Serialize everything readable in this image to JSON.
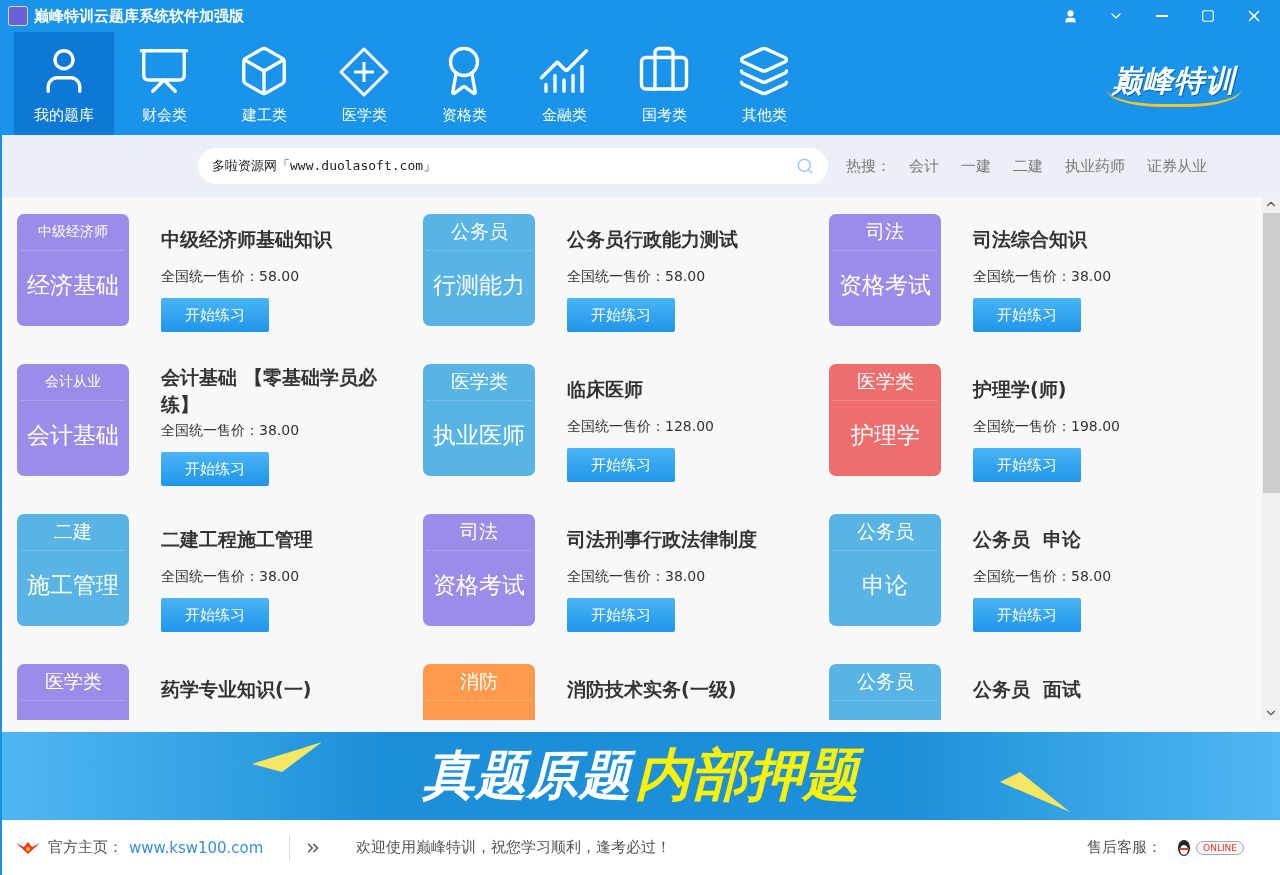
{
  "window": {
    "title": "巅峰特训云题库系统软件加强版"
  },
  "nav": [
    {
      "label": "我的题库",
      "selected": true
    },
    {
      "label": "财会类",
      "selected": false
    },
    {
      "label": "建工类",
      "selected": false
    },
    {
      "label": "医学类",
      "selected": false
    },
    {
      "label": "资格类",
      "selected": false
    },
    {
      "label": "金融类",
      "selected": false
    },
    {
      "label": "国考类",
      "selected": false
    },
    {
      "label": "其他类",
      "selected": false
    }
  ],
  "brand": "巅峰特训",
  "search": {
    "value": "多啦资源网「www.duolasoft.com」"
  },
  "hot": {
    "label": "热搜：",
    "terms": [
      "会计",
      "一建",
      "二建",
      "执业药师",
      "证券从业"
    ]
  },
  "courses": [
    {
      "tag": "中级经济师",
      "tag_small": true,
      "subject": "经济基础",
      "color": "#9a8de9",
      "title": "中级经济师基础知识",
      "price_label": "全国统一售价：",
      "price": "58.00",
      "button": "开始练习"
    },
    {
      "tag": "公务员",
      "tag_small": false,
      "subject": "行测能力",
      "color": "#58b4e4",
      "title": "公务员行政能力测试",
      "price_label": "全国统一售价：",
      "price": "58.00",
      "button": "开始练习"
    },
    {
      "tag": "司法",
      "tag_small": false,
      "subject": "资格考试",
      "color": "#9a8de9",
      "title": "司法综合知识",
      "price_label": "全国统一售价：",
      "price": "38.00",
      "button": "开始练习"
    },
    {
      "tag": "会计从业",
      "tag_small": true,
      "subject": "会计基础",
      "color": "#9a8de9",
      "title": "会计基础 【零基础学员必练】",
      "price_label": "全国统一售价：",
      "price": "38.00",
      "button": "开始练习"
    },
    {
      "tag": "医学类",
      "tag_small": false,
      "subject": "执业医师",
      "color": "#58b4e4",
      "title": "临床医师",
      "price_label": "全国统一售价：",
      "price": "128.00",
      "button": "开始练习"
    },
    {
      "tag": "医学类",
      "tag_small": false,
      "subject": "护理学",
      "color": "#ee6e6d",
      "title": "护理学(师)",
      "price_label": "全国统一售价：",
      "price": "198.00",
      "button": "开始练习"
    },
    {
      "tag": "二建",
      "tag_small": false,
      "subject": "施工管理",
      "color": "#58b4e4",
      "title": "二建工程施工管理",
      "price_label": "全国统一售价：",
      "price": "38.00",
      "button": "开始练习"
    },
    {
      "tag": "司法",
      "tag_small": false,
      "subject": "资格考试",
      "color": "#9a8de9",
      "title": "司法刑事行政法律制度",
      "price_label": "全国统一售价：",
      "price": "38.00",
      "button": "开始练习"
    },
    {
      "tag": "公务员",
      "tag_small": false,
      "subject": "申论",
      "color": "#58b4e4",
      "title": "公务员  申论",
      "price_label": "全国统一售价：",
      "price": "58.00",
      "button": "开始练习"
    },
    {
      "tag": "医学类",
      "tag_small": false,
      "color": "#9a8de9",
      "title": "药学专业知识(一)"
    },
    {
      "tag": "消防",
      "tag_small": false,
      "color": "#fd9a4d",
      "title": "消防技术实务(一级)"
    },
    {
      "tag": "公务员",
      "tag_small": false,
      "color": "#58b4e4",
      "title": "公务员  面试"
    }
  ],
  "banner": {
    "text_white": "真题原题",
    "text_yellow": "内部押题"
  },
  "footer": {
    "home_label": "官方主页：",
    "home_link": "www.ksw100.com",
    "message": "欢迎使用巅峰特训，祝您学习顺利，逢考必过！",
    "service_label": "售后客服：",
    "service_badge": "ONLINE"
  }
}
